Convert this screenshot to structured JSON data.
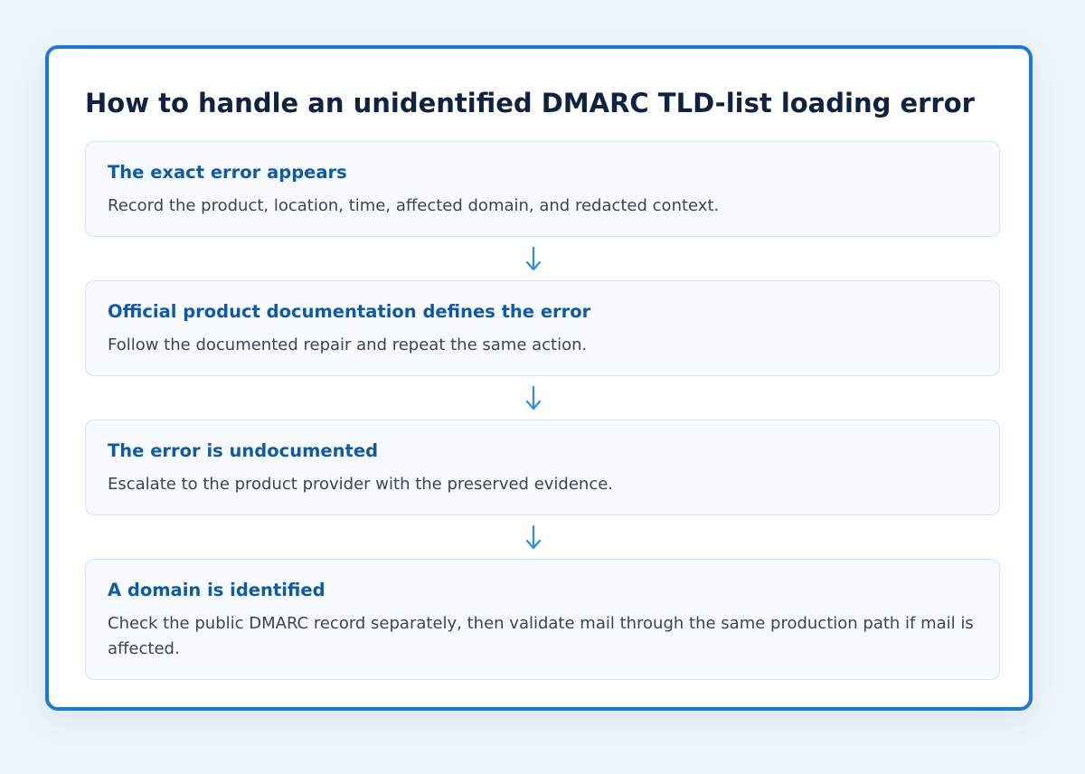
{
  "title": "How to handle an unidentified DMARC TLD-list loading error",
  "steps": [
    {
      "title": "The exact error appears",
      "description": "Record the product, location, time, affected domain, and redacted context."
    },
    {
      "title": "Official product documentation defines the error",
      "description": "Follow the documented repair and repeat the same action."
    },
    {
      "title": "The error is undocumented",
      "description": "Escalate to the product provider with the preserved evidence."
    },
    {
      "title": "A domain is identified",
      "description": "Check the public DMARC record separately, then validate mail through the same production path if mail is affected."
    }
  ],
  "colors": {
    "accent": "#1e79d6",
    "step_title": "#0d5aa7",
    "arrow": "#2b8be6"
  },
  "connector_icon": "arrow-down-icon"
}
